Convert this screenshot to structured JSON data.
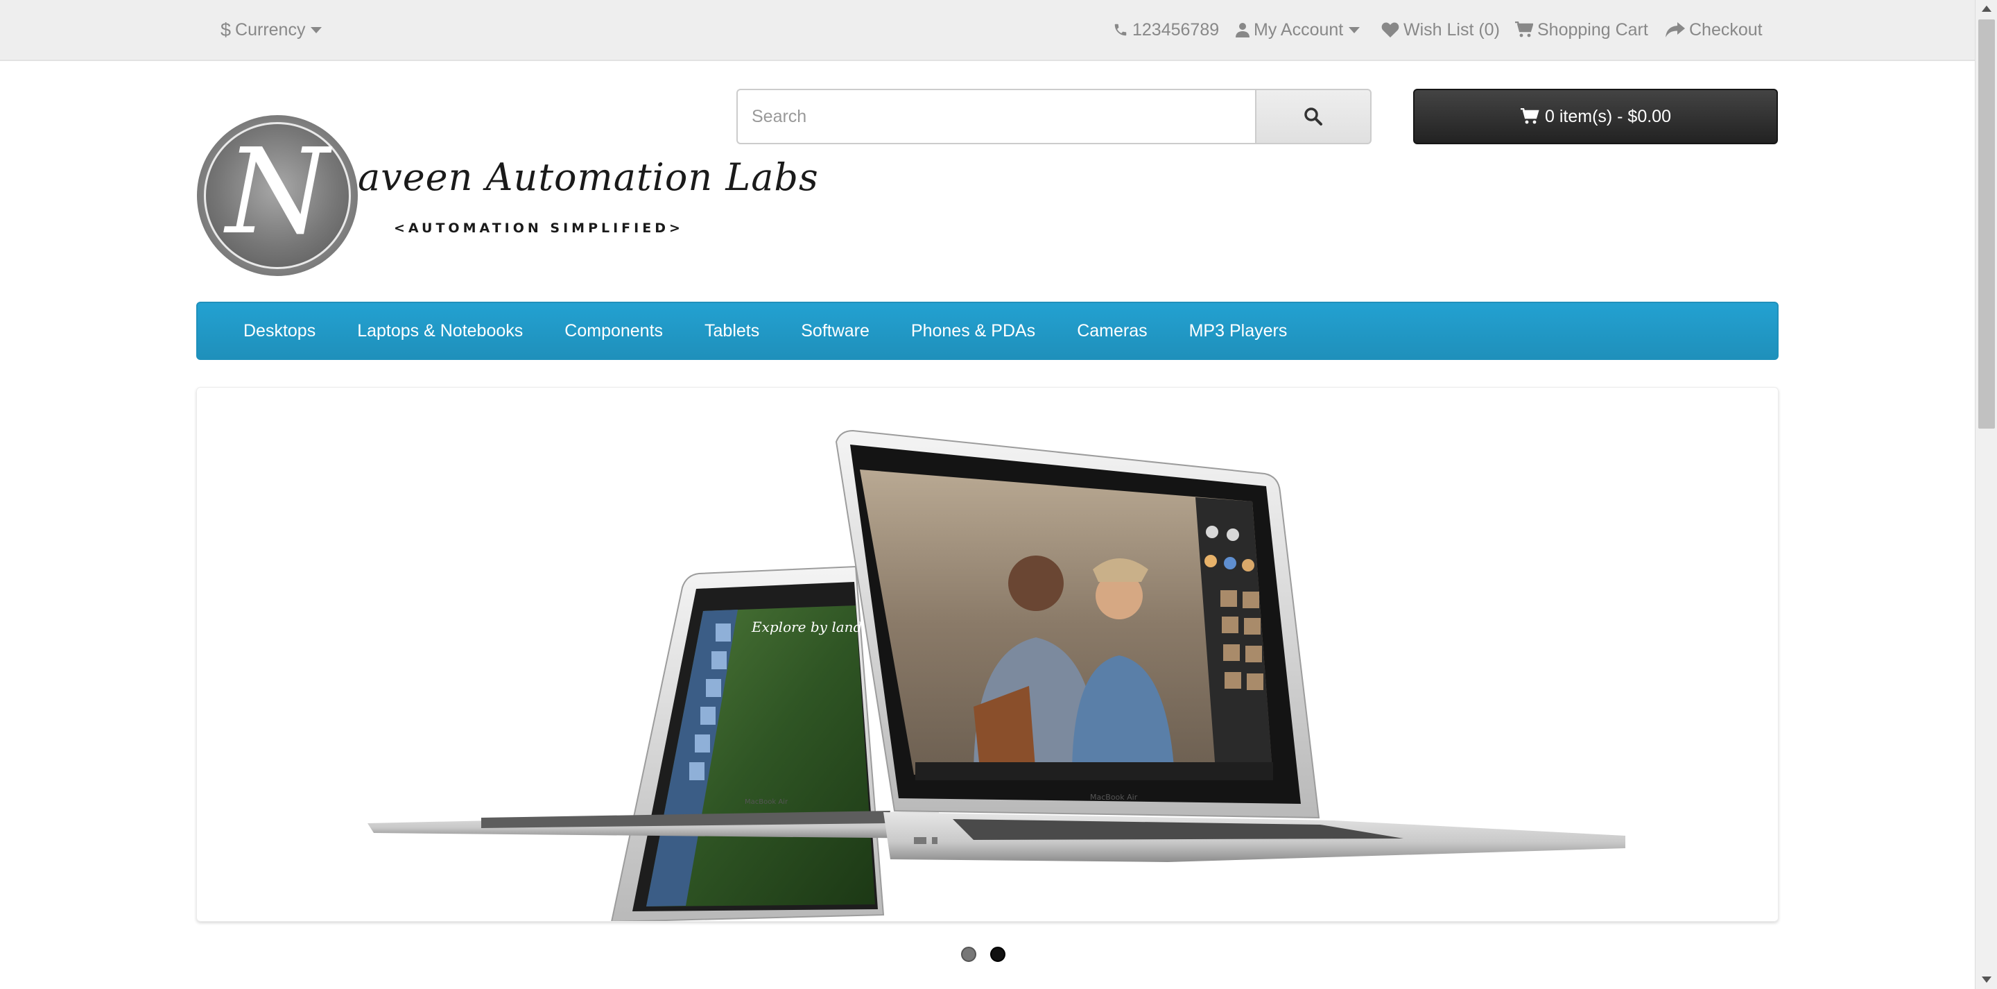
{
  "top_bar": {
    "currency": {
      "symbol": "$",
      "label": "Currency",
      "icon": "chevron-down-icon"
    },
    "phone": {
      "icon": "phone-icon",
      "label": "123456789"
    },
    "my_account": {
      "icon": "user-icon",
      "label": "My Account"
    },
    "wish_list": {
      "icon": "heart-icon",
      "label": "Wish List (0)"
    },
    "shopping_cart": {
      "icon": "cart-icon",
      "label": "Shopping Cart"
    },
    "checkout": {
      "icon": "share-icon",
      "label": "Checkout"
    }
  },
  "header": {
    "logo": {
      "letter": "N",
      "name": "aveen Automation Labs",
      "tagline": "<AUTOMATION SIMPLIFIED>"
    },
    "search": {
      "placeholder": "Search",
      "value": "",
      "button_icon": "search-icon"
    },
    "cart": {
      "icon": "cart-icon",
      "label": "0 item(s) - $0.00"
    }
  },
  "menu": {
    "items": [
      {
        "label": "Desktops"
      },
      {
        "label": "Laptops & Notebooks"
      },
      {
        "label": "Components"
      },
      {
        "label": "Tablets"
      },
      {
        "label": "Software"
      },
      {
        "label": "Phones & PDAs"
      },
      {
        "label": "Cameras"
      },
      {
        "label": "MP3 Players"
      }
    ]
  },
  "slideshow": {
    "slide_text": {
      "left_screen": "Explore by land.",
      "left_brand": "MacBook Air",
      "right_brand": "MacBook Air"
    },
    "pagination": {
      "total": 2,
      "active": 2
    }
  },
  "colors": {
    "menu_blue": "#229ac8",
    "top_bar_bg": "#eeeeee",
    "cart_button_bg": "#303030"
  }
}
